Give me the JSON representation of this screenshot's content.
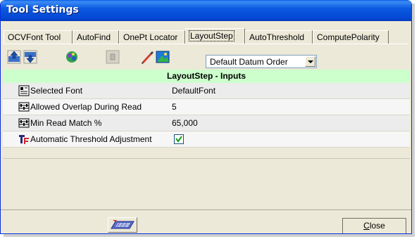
{
  "window": {
    "title": "Tool Settings"
  },
  "tabs": [
    {
      "label": "OCVFont Tool",
      "active": false
    },
    {
      "label": "AutoFind",
      "active": false
    },
    {
      "label": "OnePt Locator",
      "active": false
    },
    {
      "label": "LayoutStep",
      "active": true
    },
    {
      "label": "AutoThreshold",
      "active": false
    },
    {
      "label": "ComputePolarity",
      "active": false
    }
  ],
  "toolbar": {
    "buttons": [
      {
        "icon": "move-up-icon"
      },
      {
        "icon": "move-down-icon"
      },
      {
        "icon": "settings-blob-icon"
      },
      {
        "icon": "disabled-page-icon"
      },
      {
        "icon": "pen-icon"
      },
      {
        "icon": "image-icon"
      }
    ],
    "datum_order_select": "Default Datum Order"
  },
  "section": {
    "title": "LayoutStep - Inputs"
  },
  "inputs": [
    {
      "icon": "font-icon",
      "name": "Selected Font",
      "value": "DefaultFont"
    },
    {
      "icon": "abacus-icon",
      "name": "Allowed Overlap During Read",
      "value": "5"
    },
    {
      "icon": "abacus-icon",
      "name": "Min Read Match %",
      "value": "65,000"
    },
    {
      "icon": "threshold-icon",
      "name": "Automatic Threshold Adjustment",
      "value": "",
      "checked": true
    }
  ],
  "footer": {
    "keyboard_button_icon": "keyboard-icon",
    "close_label_first": "C",
    "close_label_rest": "lose"
  }
}
